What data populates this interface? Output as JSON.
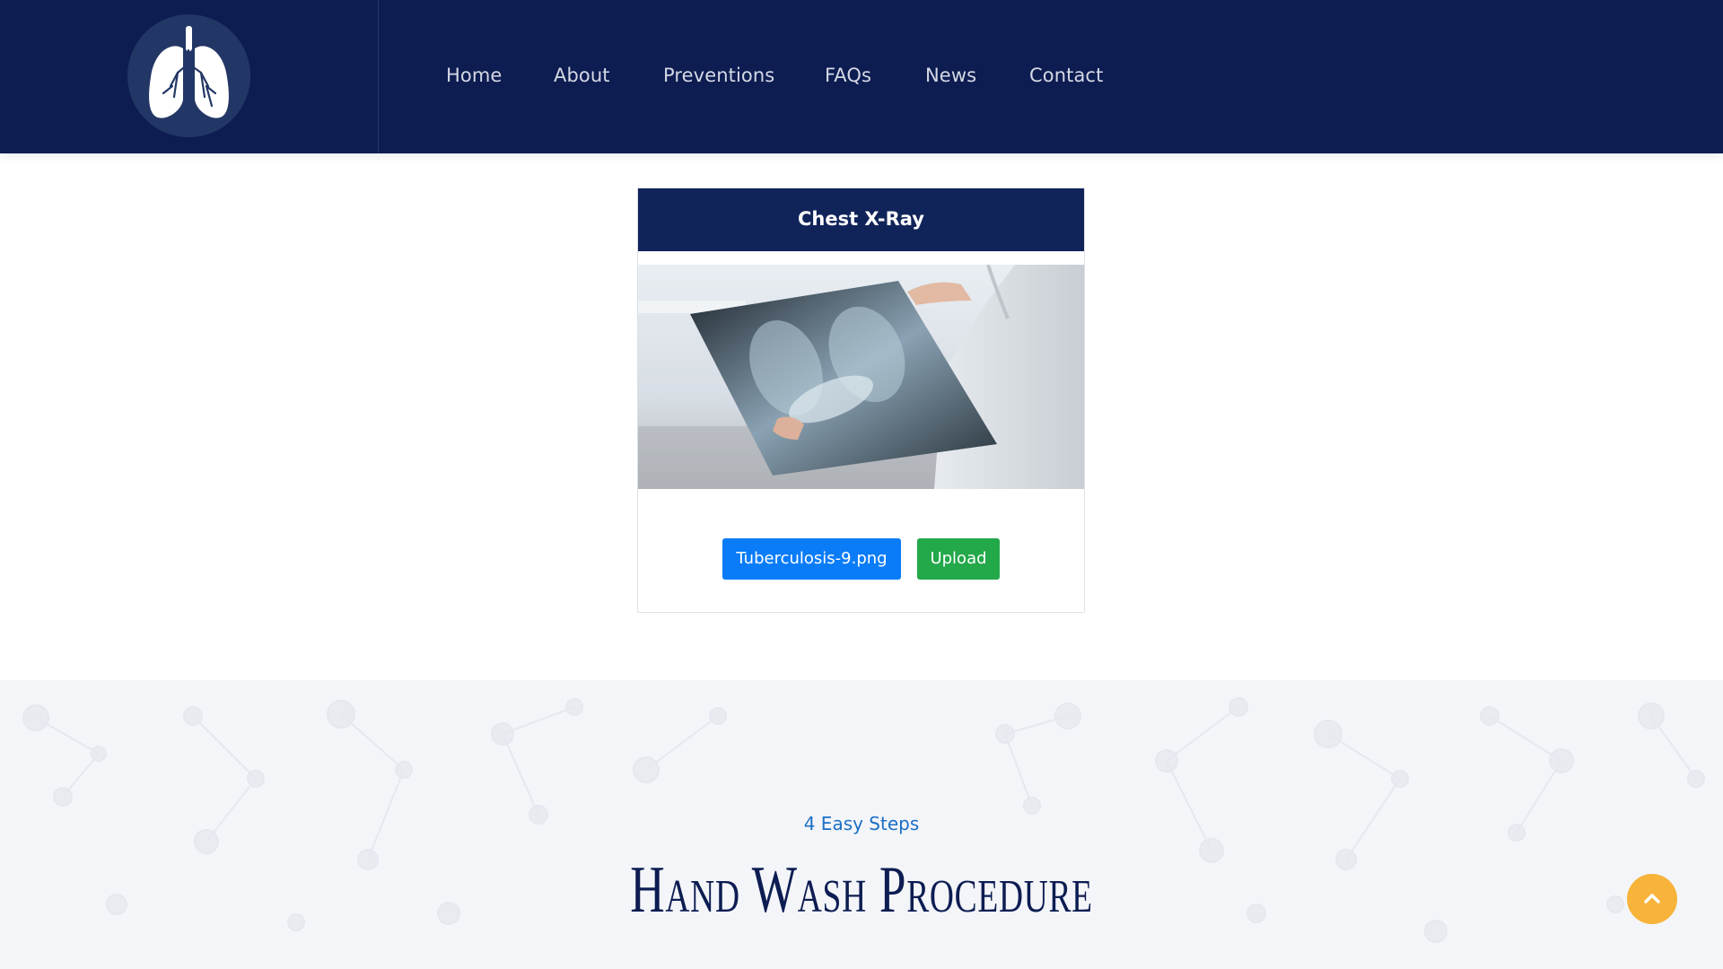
{
  "header": {
    "logo_icon": "lungs-icon",
    "nav": [
      {
        "label": "Home"
      },
      {
        "label": "About"
      },
      {
        "label": "Preventions"
      },
      {
        "label": "FAQs"
      },
      {
        "label": "News"
      },
      {
        "label": "Contact"
      }
    ]
  },
  "card": {
    "title": "Chest X-Ray",
    "image": "doctor-holding-chest-xray",
    "file_button_label": "Tuberculosis-9.png",
    "upload_button_label": "Upload"
  },
  "steps": {
    "subtitle": "4 Easy Steps",
    "title": "Hand Wash Procedure"
  },
  "scroll_top_icon": "chevron-up-icon",
  "colors": {
    "header_bg": "#0d1d52",
    "card_header_bg": "#11245a",
    "file_button": "#0a7cf8",
    "upload_button": "#23a84a",
    "accent_blue": "#1b6fc4",
    "scroll_top": "#f7b33a"
  }
}
